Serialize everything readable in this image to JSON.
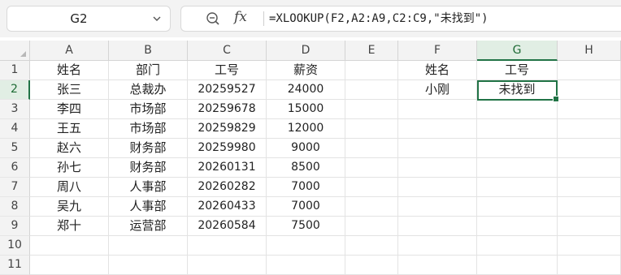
{
  "formula_bar": {
    "cell_ref": "G2",
    "formula": "=XLOOKUP(F2,A2:A9,C2:C9,\"未找到\")",
    "zoom_icon": "zoom-icon",
    "fx_icon": "fx"
  },
  "columns": [
    "A",
    "B",
    "C",
    "D",
    "E",
    "F",
    "G",
    "H"
  ],
  "rows": [
    "1",
    "2",
    "3",
    "4",
    "5",
    "6",
    "7",
    "8",
    "9",
    "10",
    "11"
  ],
  "selected_column": "G",
  "selected_row": "2",
  "table": {
    "headers": [
      "姓名",
      "部门",
      "工号",
      "薪资"
    ],
    "rows": [
      [
        "张三",
        "总裁办",
        "20259527",
        "24000"
      ],
      [
        "李四",
        "市场部",
        "20259678",
        "15000"
      ],
      [
        "王五",
        "市场部",
        "20259829",
        "12000"
      ],
      [
        "赵六",
        "财务部",
        "20259980",
        "9000"
      ],
      [
        "孙七",
        "财务部",
        "20260131",
        "8500"
      ],
      [
        "周八",
        "人事部",
        "20260282",
        "7000"
      ],
      [
        "吴九",
        "人事部",
        "20260433",
        "7000"
      ],
      [
        "郑十",
        "运营部",
        "20260584",
        "7500"
      ]
    ]
  },
  "lookup": {
    "header_name": "姓名",
    "header_id": "工号",
    "input_name": "小刚",
    "result": "未找到"
  },
  "colors": {
    "accent": "#217346",
    "header_bg": "#f3f3f3",
    "selected_header_bg": "#e1eee4"
  }
}
